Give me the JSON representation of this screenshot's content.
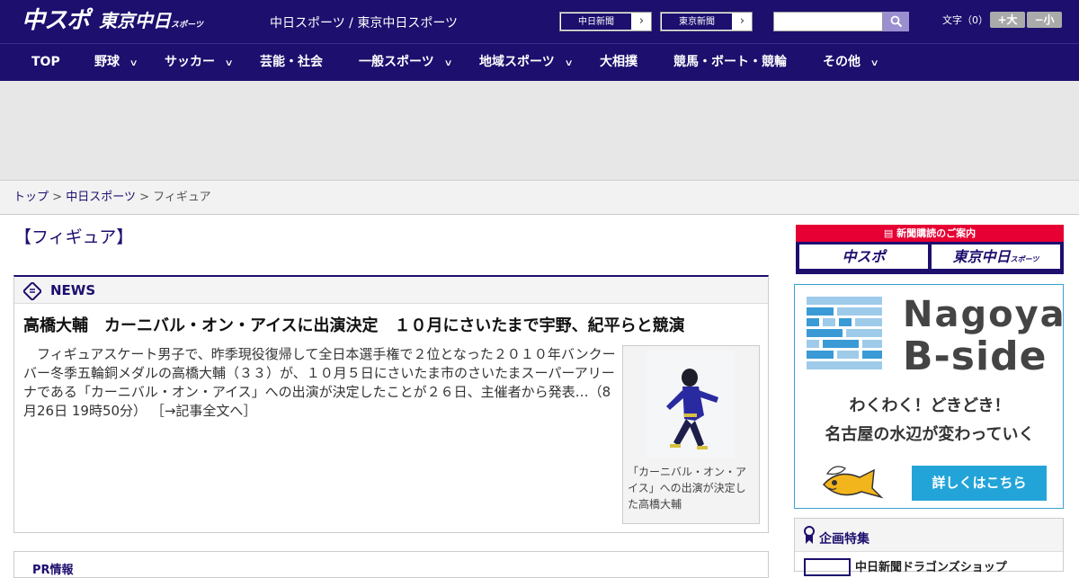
{
  "header": {
    "logo_main": "中スポ",
    "logo_tokyo": "東京中日",
    "logo_tokyo_small": "スポーツ",
    "site_names": "中日スポーツ / 東京中日スポーツ",
    "paper_links": [
      {
        "label": "中日新聞",
        "arrow": "›"
      },
      {
        "label": "東京新聞",
        "arrow": "›"
      }
    ],
    "search": {
      "placeholder": "",
      "value": ""
    },
    "text_size": {
      "label": "文字（0）",
      "increase": "+大",
      "decrease": "−小"
    }
  },
  "nav": {
    "items": [
      {
        "label": "TOP",
        "has_menu": false
      },
      {
        "label": "野球",
        "has_menu": true
      },
      {
        "label": "サッカー",
        "has_menu": true
      },
      {
        "label": "芸能・社会",
        "has_menu": false
      },
      {
        "label": "一般スポーツ",
        "has_menu": true
      },
      {
        "label": "地域スポーツ",
        "has_menu": true
      },
      {
        "label": "大相撲",
        "has_menu": false
      },
      {
        "label": "競馬・ボート・競輪",
        "has_menu": false
      },
      {
        "label": "その他",
        "has_menu": true
      }
    ],
    "chevron": "∨"
  },
  "breadcrumb": {
    "items": [
      "トップ",
      "中日スポーツ"
    ],
    "separator": ">",
    "current": "フィギュア"
  },
  "main": {
    "section_title": "【フィギュア】",
    "news": {
      "heading": "NEWS",
      "headline": "高橋大輔　カーニバル・オン・アイスに出演決定　１０月にさいたまで宇野、紀平らと競演",
      "lead": "　フィギュアスケート男子で、昨季現役復帰して全日本選手権で２位となった２０１０年バンクーバー冬季五輪銅メダルの高橋大輔（３３）が、１０月５日にさいたま市のさいたまスーパーアリーナである「カーニバル・オン・アイス」への出演が決定したことが２６日、主催者から発表…（8月26日 19時50分）",
      "more": "［→記事全文へ］",
      "photo_caption": "「カーニバル・オン・アイス」への出演が決定した高橋大輔"
    },
    "pr_heading": "PR情報"
  },
  "sidebar": {
    "subscribe": {
      "banner": "新聞購読のご案内",
      "buttons": [
        "中スポ",
        "東京中日"
      ],
      "tokyo_small": "スポーツ"
    },
    "bside": {
      "title1": "Nagoya",
      "title2": "B-side",
      "sub1": "わくわく！どきどき！",
      "sub2": "名古屋の水辺が変わっていく",
      "button": "詳しくはこちら"
    },
    "feature": {
      "heading": "企画特集",
      "first_item": "中日新聞ドラゴンズショップ"
    }
  },
  "colors": {
    "brand": "#1c0f6e",
    "accent_red": "#e60033",
    "bside_blue": "#23a4d9"
  }
}
